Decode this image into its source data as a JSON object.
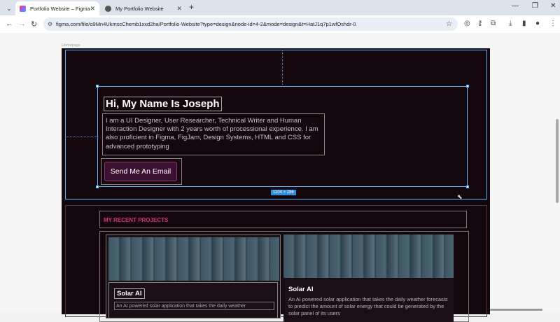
{
  "browser": {
    "tabs": [
      {
        "title": "Portfolio Website – Figma",
        "active": true
      },
      {
        "title": "My Portfolio Website",
        "active": false
      }
    ],
    "url": "figma.com/file/o9Mn4UkmscChemb1xxd2ha/Portfolio-Website?type=design&node-id=4-2&mode=design&t=HatJ1q7p1wfOshdr-0"
  },
  "canvas": {
    "frame_label": "Homepage",
    "selection_size": "1104 × 286"
  },
  "hero": {
    "heading": "Hi, My Name Is Joseph",
    "intro": "I am a UI Designer, User Researcher, Technical Writer and Human Interaction Designer with 2 years worth of processional experience. I am also proficient in Figma, FigJam, Design Systems, HTML and CSS for advanced prototyping",
    "cta_label": "Send Me An Email"
  },
  "projects": {
    "section_title": "MY RECENT PROJECTS",
    "cards": [
      {
        "title": "Solar AI",
        "description": "An AI powered solar application that takes the daily weather"
      },
      {
        "title": "Solar AI",
        "description": "An AI powered solar application that takes the daily weather forecasts to predict the amount of solar energy that could be generated by the solar panel of its users"
      }
    ]
  },
  "colors": {
    "page_bg": "#14070e",
    "selection": "#5fb4ff",
    "accent_pink": "#d6337f",
    "button_bg": "#3b1030"
  }
}
